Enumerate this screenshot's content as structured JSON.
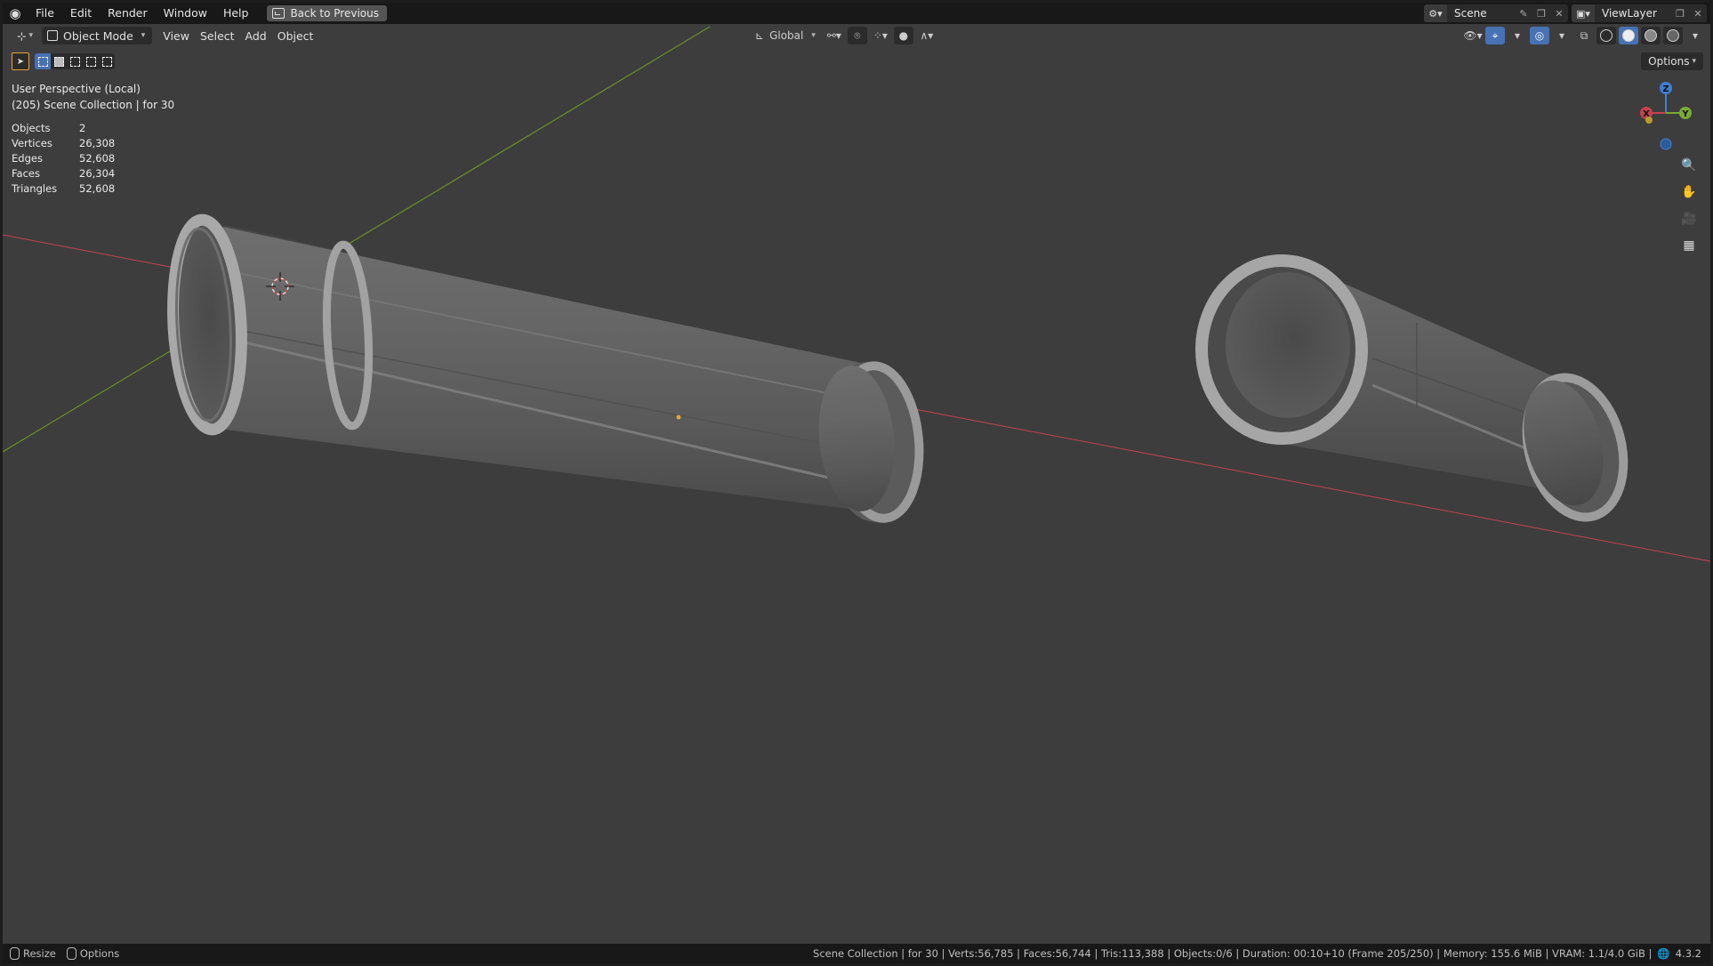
{
  "menu": {
    "items": [
      "File",
      "Edit",
      "Render",
      "Window",
      "Help"
    ],
    "back_button": "Back to Previous"
  },
  "top_right": {
    "scene": "Scene",
    "view_layer": "ViewLayer"
  },
  "viewport_header": {
    "mode": "Object Mode",
    "menus": [
      "View",
      "Select",
      "Add",
      "Object"
    ],
    "transform_orientation": "Global",
    "options": "Options"
  },
  "overlay": {
    "view_name": "User Perspective (Local)",
    "collection": "(205) Scene Collection | for 30"
  },
  "stats": [
    {
      "label": "Objects",
      "value": "2"
    },
    {
      "label": "Vertices",
      "value": "26,308"
    },
    {
      "label": "Edges",
      "value": "52,608"
    },
    {
      "label": "Faces",
      "value": "26,304"
    },
    {
      "label": "Triangles",
      "value": "52,608"
    }
  ],
  "gizmo": {
    "x": "X",
    "y": "Y",
    "z": "Z"
  },
  "statusbar": {
    "resize": "Resize",
    "options": "Options",
    "info": "Scene Collection | for 30 | Verts:56,785 | Faces:56,744 | Tris:113,388 | Objects:0/6 | Duration: 00:10+10 (Frame 205/250) | Memory: 155.6 MiB | VRAM: 1.1/4.0 GiB |",
    "version": "4.3.2"
  },
  "colors": {
    "accent_blue": "#4772b3",
    "axis_x": "#c4424e",
    "axis_y": "#6b8f2a",
    "axis_z": "#3f7fd6",
    "viewport_bg": "#3d3d3d"
  }
}
